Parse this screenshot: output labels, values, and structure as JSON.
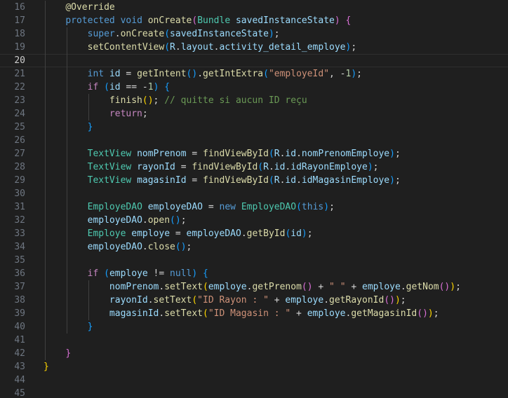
{
  "colors": {
    "background": "#1f1f1f",
    "line_number": "#6e7681",
    "keyword": "#569cd6",
    "control": "#c586c0",
    "type": "#4ec9b0",
    "function": "#dcdcaa",
    "variable": "#9cdcfe",
    "string": "#ce9178",
    "number": "#b5cea8",
    "comment": "#6a9955",
    "bracket_1": "#ffd700",
    "bracket_2": "#da70d6",
    "bracket_3": "#179fff"
  },
  "editor": {
    "current_line_number": 20,
    "lines": [
      {
        "n": "16",
        "indent": 1,
        "tokens": [
          [
            "ann",
            "@Override"
          ]
        ]
      },
      {
        "n": "17",
        "indent": 1,
        "tokens": [
          [
            "kw",
            "protected"
          ],
          [
            "p",
            " "
          ],
          [
            "kw",
            "void"
          ],
          [
            "p",
            " "
          ],
          [
            "fn",
            "onCreate"
          ],
          [
            "b2",
            "("
          ],
          [
            "ty",
            "Bundle"
          ],
          [
            "p",
            " "
          ],
          [
            "var",
            "savedInstanceState"
          ],
          [
            "b2",
            ")"
          ],
          [
            "p",
            " "
          ],
          [
            "b2",
            "{"
          ]
        ]
      },
      {
        "n": "18",
        "indent": 2,
        "tokens": [
          [
            "kw",
            "super"
          ],
          [
            "p",
            "."
          ],
          [
            "fn",
            "onCreate"
          ],
          [
            "b3",
            "("
          ],
          [
            "var",
            "savedInstanceState"
          ],
          [
            "b3",
            ")"
          ],
          [
            "p",
            ";"
          ]
        ]
      },
      {
        "n": "19",
        "indent": 2,
        "tokens": [
          [
            "fn",
            "setContentView"
          ],
          [
            "b3",
            "("
          ],
          [
            "var",
            "R"
          ],
          [
            "p",
            "."
          ],
          [
            "var",
            "layout"
          ],
          [
            "p",
            "."
          ],
          [
            "var",
            "activity_detail_employe"
          ],
          [
            "b3",
            ")"
          ],
          [
            "p",
            ";"
          ]
        ]
      },
      {
        "n": "20",
        "indent": 0,
        "tokens": []
      },
      {
        "n": "21",
        "indent": 2,
        "tokens": [
          [
            "kw",
            "int"
          ],
          [
            "p",
            " "
          ],
          [
            "var",
            "id"
          ],
          [
            "p",
            " = "
          ],
          [
            "fn",
            "getIntent"
          ],
          [
            "b3",
            "()"
          ],
          [
            "p",
            "."
          ],
          [
            "fn",
            "getIntExtra"
          ],
          [
            "b3",
            "("
          ],
          [
            "str",
            "\"employeId\""
          ],
          [
            "p",
            ", -"
          ],
          [
            "num",
            "1"
          ],
          [
            "b3",
            ")"
          ],
          [
            "p",
            ";"
          ]
        ]
      },
      {
        "n": "22",
        "indent": 2,
        "tokens": [
          [
            "ctrl",
            "if"
          ],
          [
            "p",
            " "
          ],
          [
            "b3",
            "("
          ],
          [
            "var",
            "id"
          ],
          [
            "p",
            " == -"
          ],
          [
            "num",
            "1"
          ],
          [
            "b3",
            ")"
          ],
          [
            "p",
            " "
          ],
          [
            "b3",
            "{"
          ]
        ]
      },
      {
        "n": "23",
        "indent": 3,
        "tokens": [
          [
            "fn",
            "finish"
          ],
          [
            "b1",
            "()"
          ],
          [
            "p",
            "; "
          ],
          [
            "com",
            "// quitte si aucun ID reçu"
          ]
        ]
      },
      {
        "n": "24",
        "indent": 3,
        "tokens": [
          [
            "ctrl",
            "return"
          ],
          [
            "p",
            ";"
          ]
        ]
      },
      {
        "n": "25",
        "indent": 2,
        "tokens": [
          [
            "b3",
            "}"
          ]
        ]
      },
      {
        "n": "26",
        "indent": 0,
        "tokens": []
      },
      {
        "n": "27",
        "indent": 2,
        "tokens": [
          [
            "ty",
            "TextView"
          ],
          [
            "p",
            " "
          ],
          [
            "var",
            "nomPrenom"
          ],
          [
            "p",
            " = "
          ],
          [
            "fn",
            "findViewById"
          ],
          [
            "b3",
            "("
          ],
          [
            "var",
            "R"
          ],
          [
            "p",
            "."
          ],
          [
            "var",
            "id"
          ],
          [
            "p",
            "."
          ],
          [
            "var",
            "nomPrenomEmploye"
          ],
          [
            "b3",
            ")"
          ],
          [
            "p",
            ";"
          ]
        ]
      },
      {
        "n": "28",
        "indent": 2,
        "tokens": [
          [
            "ty",
            "TextView"
          ],
          [
            "p",
            " "
          ],
          [
            "var",
            "rayonId"
          ],
          [
            "p",
            " = "
          ],
          [
            "fn",
            "findViewById"
          ],
          [
            "b3",
            "("
          ],
          [
            "var",
            "R"
          ],
          [
            "p",
            "."
          ],
          [
            "var",
            "id"
          ],
          [
            "p",
            "."
          ],
          [
            "var",
            "idRayonEmploye"
          ],
          [
            "b3",
            ")"
          ],
          [
            "p",
            ";"
          ]
        ]
      },
      {
        "n": "29",
        "indent": 2,
        "tokens": [
          [
            "ty",
            "TextView"
          ],
          [
            "p",
            " "
          ],
          [
            "var",
            "magasinId"
          ],
          [
            "p",
            " = "
          ],
          [
            "fn",
            "findViewById"
          ],
          [
            "b3",
            "("
          ],
          [
            "var",
            "R"
          ],
          [
            "p",
            "."
          ],
          [
            "var",
            "id"
          ],
          [
            "p",
            "."
          ],
          [
            "var",
            "idMagasinEmploye"
          ],
          [
            "b3",
            ")"
          ],
          [
            "p",
            ";"
          ]
        ]
      },
      {
        "n": "30",
        "indent": 0,
        "tokens": []
      },
      {
        "n": "31",
        "indent": 2,
        "tokens": [
          [
            "ty",
            "EmployeDAO"
          ],
          [
            "p",
            " "
          ],
          [
            "var",
            "employeDAO"
          ],
          [
            "p",
            " = "
          ],
          [
            "kw",
            "new"
          ],
          [
            "p",
            " "
          ],
          [
            "ty",
            "EmployeDAO"
          ],
          [
            "b3",
            "("
          ],
          [
            "kw",
            "this"
          ],
          [
            "b3",
            ")"
          ],
          [
            "p",
            ";"
          ]
        ]
      },
      {
        "n": "32",
        "indent": 2,
        "tokens": [
          [
            "var",
            "employeDAO"
          ],
          [
            "p",
            "."
          ],
          [
            "fn",
            "open"
          ],
          [
            "b3",
            "()"
          ],
          [
            "p",
            ";"
          ]
        ]
      },
      {
        "n": "33",
        "indent": 2,
        "tokens": [
          [
            "ty",
            "Employe"
          ],
          [
            "p",
            " "
          ],
          [
            "var",
            "employe"
          ],
          [
            "p",
            " = "
          ],
          [
            "var",
            "employeDAO"
          ],
          [
            "p",
            "."
          ],
          [
            "fn",
            "getById"
          ],
          [
            "b3",
            "("
          ],
          [
            "var",
            "id"
          ],
          [
            "b3",
            ")"
          ],
          [
            "p",
            ";"
          ]
        ]
      },
      {
        "n": "34",
        "indent": 2,
        "tokens": [
          [
            "var",
            "employeDAO"
          ],
          [
            "p",
            "."
          ],
          [
            "fn",
            "close"
          ],
          [
            "b3",
            "()"
          ],
          [
            "p",
            ";"
          ]
        ]
      },
      {
        "n": "35",
        "indent": 0,
        "tokens": []
      },
      {
        "n": "36",
        "indent": 2,
        "tokens": [
          [
            "ctrl",
            "if"
          ],
          [
            "p",
            " "
          ],
          [
            "b3",
            "("
          ],
          [
            "var",
            "employe"
          ],
          [
            "p",
            " != "
          ],
          [
            "kw",
            "null"
          ],
          [
            "b3",
            ")"
          ],
          [
            "p",
            " "
          ],
          [
            "b3",
            "{"
          ]
        ]
      },
      {
        "n": "37",
        "indent": 3,
        "tokens": [
          [
            "var",
            "nomPrenom"
          ],
          [
            "p",
            "."
          ],
          [
            "fn",
            "setText"
          ],
          [
            "b1",
            "("
          ],
          [
            "var",
            "employe"
          ],
          [
            "p",
            "."
          ],
          [
            "fn",
            "getPrenom"
          ],
          [
            "b2",
            "()"
          ],
          [
            "p",
            " + "
          ],
          [
            "str",
            "\" \""
          ],
          [
            "p",
            " + "
          ],
          [
            "var",
            "employe"
          ],
          [
            "p",
            "."
          ],
          [
            "fn",
            "getNom"
          ],
          [
            "b2",
            "()"
          ],
          [
            "b1",
            ")"
          ],
          [
            "p",
            ";"
          ]
        ]
      },
      {
        "n": "38",
        "indent": 3,
        "tokens": [
          [
            "var",
            "rayonId"
          ],
          [
            "p",
            "."
          ],
          [
            "fn",
            "setText"
          ],
          [
            "b1",
            "("
          ],
          [
            "str",
            "\"ID Rayon : \""
          ],
          [
            "p",
            " + "
          ],
          [
            "var",
            "employe"
          ],
          [
            "p",
            "."
          ],
          [
            "fn",
            "getRayonId"
          ],
          [
            "b2",
            "()"
          ],
          [
            "b1",
            ")"
          ],
          [
            "p",
            ";"
          ]
        ]
      },
      {
        "n": "39",
        "indent": 3,
        "tokens": [
          [
            "var",
            "magasinId"
          ],
          [
            "p",
            "."
          ],
          [
            "fn",
            "setText"
          ],
          [
            "b1",
            "("
          ],
          [
            "str",
            "\"ID Magasin : \""
          ],
          [
            "p",
            " + "
          ],
          [
            "var",
            "employe"
          ],
          [
            "p",
            "."
          ],
          [
            "fn",
            "getMagasinId"
          ],
          [
            "b2",
            "()"
          ],
          [
            "b1",
            ")"
          ],
          [
            "p",
            ";"
          ]
        ]
      },
      {
        "n": "40",
        "indent": 2,
        "tokens": [
          [
            "b3",
            "}"
          ]
        ]
      },
      {
        "n": "41",
        "indent": 0,
        "tokens": []
      },
      {
        "n": "42",
        "indent": 1,
        "tokens": [
          [
            "b2",
            "}"
          ]
        ]
      },
      {
        "n": "43",
        "indent": 0,
        "tokens": [
          [
            "b1",
            "}"
          ]
        ]
      },
      {
        "n": "44",
        "indent": 0,
        "tokens": []
      },
      {
        "n": "45",
        "indent": 0,
        "tokens": []
      }
    ]
  }
}
